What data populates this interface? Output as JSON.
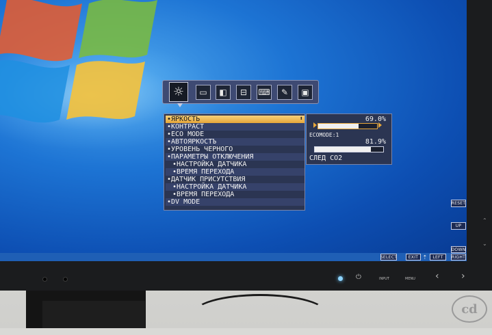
{
  "osd": {
    "tabs": [
      {
        "icon": "brightness-icon",
        "glyph": "☼",
        "active": true
      },
      {
        "icon": "screen-size-icon",
        "glyph": "▭"
      },
      {
        "icon": "color-icon",
        "glyph": "◧"
      },
      {
        "icon": "toolbox-icon",
        "glyph": "⊟"
      },
      {
        "icon": "keyboard-icon",
        "glyph": "⌨"
      },
      {
        "icon": "tools-icon",
        "glyph": "✎"
      },
      {
        "icon": "information-icon",
        "glyph": "▣"
      }
    ],
    "menu": [
      {
        "label": "•ЯРКОСТЬ",
        "selected": true
      },
      {
        "label": "•КОНТРАСТ"
      },
      {
        "label": "•ECO MODE"
      },
      {
        "label": "•АВТОЯРКОСТЪ"
      },
      {
        "label": "•УРОВЕНЬ ЧЕРНОГО"
      },
      {
        "label": "•ПАРАМЕТРЫ ОТКЛЮЧЕНИЯ"
      },
      {
        "label": "•НАСТРОЙКА ДАТЧИКА",
        "sub": true
      },
      {
        "label": "•ВРЕМЯ ПЕРЕХОДА",
        "sub": true
      },
      {
        "label": "•ДАТЧИК ПРИСУТСТВИЯ"
      },
      {
        "label": "•НАСТРОЙКА ДАТЧИКА",
        "sub": true
      },
      {
        "label": "•ВРЕМЯ ПЕРЕХОДА",
        "sub": true
      },
      {
        "label": "•DV MODE"
      }
    ],
    "panel": {
      "brightness_pct_text": "69.0%",
      "brightness_value": 0.69,
      "ecomode_label": "ECOMODE:1",
      "eco_pct_text": "81.9%",
      "eco_value": 0.819,
      "status": "СЛЕД CO2"
    }
  },
  "guides": {
    "reset": "RESET",
    "up": "UP",
    "down": "DOWN",
    "right": "RIGHT",
    "select": "SELECT",
    "exit": "EXIT",
    "left": "LEFT",
    "exit_glyph": "⇡"
  },
  "bezel": {
    "power_glyph": "⏻",
    "input": "INPUT",
    "menu": "MENU",
    "left_glyph": "‹",
    "right_glyph": "›",
    "side_up_glyph": "⌃",
    "side_down_glyph": "⌄"
  },
  "colors": {
    "osd_bg": "#2b3552",
    "highlight": "#e7a73a",
    "desktop": "#1d74d4"
  }
}
